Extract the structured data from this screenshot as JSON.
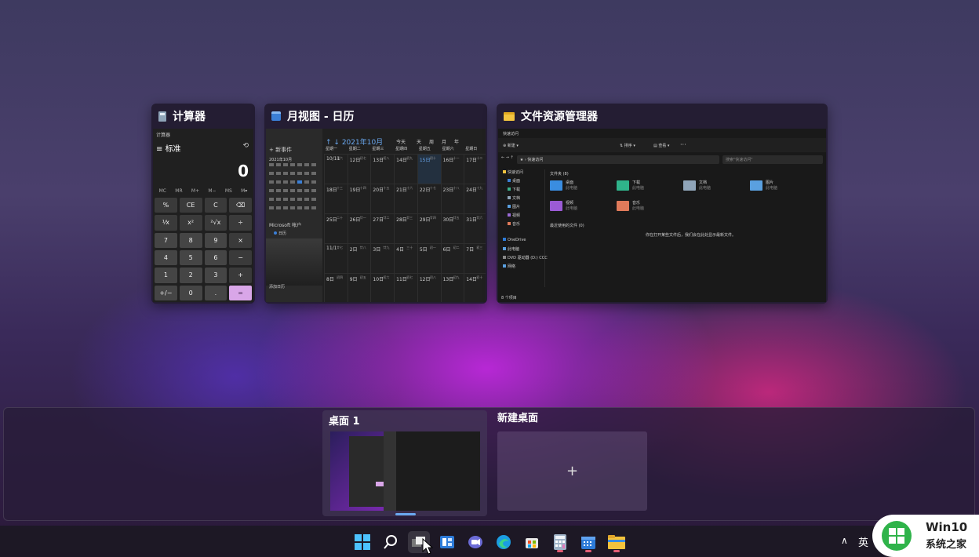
{
  "windows": {
    "calculator": {
      "title": "计算器",
      "app_title": "计算器",
      "mode": "标准",
      "display": "0",
      "memory_keys": [
        "MC",
        "MR",
        "M+",
        "M−",
        "MS",
        "M▾"
      ],
      "keys": [
        "%",
        "CE",
        "C",
        "⌫",
        "⅟x",
        "x²",
        "²√x",
        "÷",
        "7",
        "8",
        "9",
        "×",
        "4",
        "5",
        "6",
        "−",
        "1",
        "2",
        "3",
        "+",
        "+/−",
        "0",
        ".",
        "="
      ]
    },
    "calendar": {
      "title": "月视图 - 日历",
      "month": "2021年10月",
      "today": "今天",
      "new_event": "新事件",
      "mini_month": "2021年10月",
      "account": "Microsoft 帐户",
      "calendar_name": "日历",
      "add_calendar": "添加日历",
      "view_tabs": [
        "天",
        "周",
        "月",
        "年"
      ],
      "weekdays": [
        "星期一",
        "星期二",
        "星期三",
        "星期四",
        "星期五",
        "星期六",
        "星期日"
      ],
      "weeks": [
        [
          "10/11",
          "12日",
          "13日",
          "14日",
          "15日",
          "16日",
          "17日"
        ],
        [
          "18日",
          "19日",
          "20日",
          "21日",
          "22日",
          "23日",
          "24日"
        ],
        [
          "25日",
          "26日",
          "27日",
          "28日",
          "29日",
          "30日",
          "31日"
        ],
        [
          "11/1",
          "2日",
          "3日",
          "4日",
          "5日",
          "6日",
          "7日"
        ],
        [
          "8日",
          "9日",
          "10日",
          "11日",
          "12日",
          "13日",
          "14日"
        ]
      ],
      "lunar": [
        [
          "初六",
          "初七",
          "初八",
          "初九",
          "初十",
          "十一",
          "十二"
        ],
        [
          "十三",
          "十四",
          "十五",
          "十六",
          "十七",
          "十八",
          "十九"
        ],
        [
          "二十",
          "廿一",
          "廿二",
          "廿三",
          "廿四",
          "廿五",
          "廿六"
        ],
        [
          "廿七",
          "廿八",
          "廿九",
          "三十",
          "初一",
          "初二",
          "初三"
        ],
        [
          "初四",
          "初五",
          "初六",
          "初七",
          "初八",
          "初九",
          "初十"
        ]
      ]
    },
    "explorer": {
      "title": "文件资源管理器",
      "app_title": "快速访问",
      "new_label": "新建",
      "sort_label": "排序",
      "view_label": "查看",
      "address": "快速访问",
      "search_placeholder": "搜索\"快速访问\"",
      "nav_items": [
        "快速访问",
        "桌面",
        "下载",
        "文档",
        "图片",
        "视频",
        "音乐",
        "OneDrive",
        "此电脑",
        "DVD 驱动器 (D:) CCC",
        "网络"
      ],
      "frequent_header": "文件夹 (8)",
      "folders": [
        {
          "name": "桌面",
          "sub": "此电脑"
        },
        {
          "name": "下载",
          "sub": "此电脑"
        },
        {
          "name": "文档",
          "sub": "此电脑"
        },
        {
          "name": "图片",
          "sub": "此电脑"
        },
        {
          "name": "视频",
          "sub": "此电脑"
        },
        {
          "name": "音乐",
          "sub": "此电脑"
        }
      ],
      "recent_header": "最近使用的文件 (0)",
      "recent_empty": "你在打开某些文件后，我们会在此处显示最新文件。",
      "status": "8 个项目"
    }
  },
  "desktops": {
    "desktop1": "桌面 1",
    "new_desktop": "新建桌面",
    "plus": "+"
  },
  "taskbar": {
    "lang": "英",
    "icons": [
      "start-icon",
      "search-icon",
      "task-view-icon",
      "widgets-icon",
      "chat-icon",
      "edge-icon",
      "store-icon",
      "calculator-icon",
      "calendar-icon",
      "file-explorer-icon"
    ]
  },
  "watermark": {
    "line1": "Win10",
    "line2": "系统之家"
  }
}
